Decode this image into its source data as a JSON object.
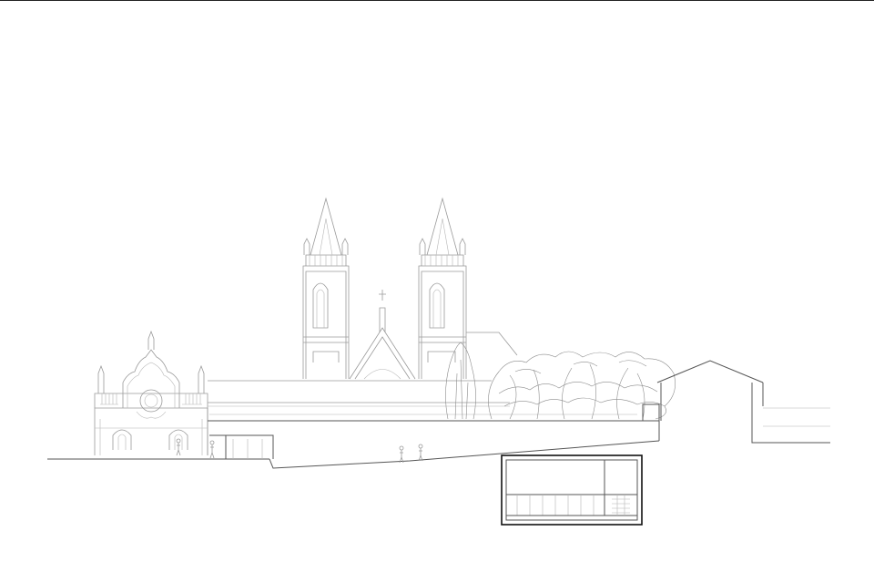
{
  "drawing": {
    "kind": "architectural-elevation-section",
    "colors": {
      "line": "#9a9a9a",
      "cut": "#111111",
      "background": "#ffffff"
    },
    "elements": [
      "ground-line",
      "baroque-gable-facade",
      "twin-tower-church",
      "tree-group",
      "gabled-house",
      "underground-gallery-section"
    ],
    "figures": 4
  }
}
